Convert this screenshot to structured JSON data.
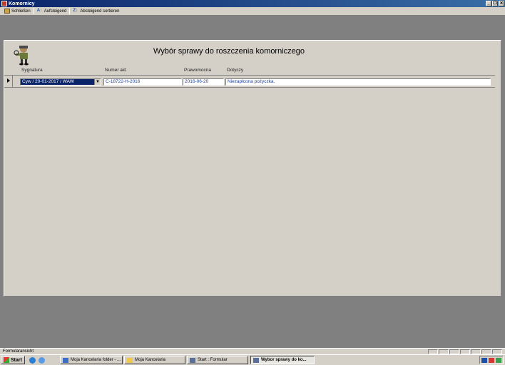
{
  "window": {
    "title": "Komornicy"
  },
  "toolbar": {
    "close_label": "Schließen",
    "asc_label": "Aufsteigend",
    "desc_label": "Absteigend sortieren"
  },
  "form": {
    "title": "Wybór sprawy do roszczenia komorniczego",
    "columns": {
      "sygnatura": "Sygnatura",
      "numer_akt": "Numer akt",
      "prawomocna": "Prawomocna",
      "dotyczy": "Dotyczy"
    },
    "record": {
      "sygnatura": "Cyw / 20-01-2017 / WAW",
      "numer_akt": "C-18722-H-2016",
      "prawomocna": "2016-06-20",
      "dotyczy": "Niezapłcona pożyczka."
    }
  },
  "statusbar": {
    "text": "Formularansicht"
  },
  "taskbar": {
    "start_label": "Start",
    "tasks": [
      "Moja Kancelaria folder - ...",
      "Moja Kancelaria",
      "Start : Formular",
      "Wybor sprawy do ko..."
    ]
  },
  "icons": [
    "app-icon",
    "close-folder-icon",
    "sort-asc-icon",
    "sort-desc-icon",
    "mascot-icon",
    "dropdown-arrow-icon",
    "record-selector-icon",
    "windows-flag-icon"
  ]
}
